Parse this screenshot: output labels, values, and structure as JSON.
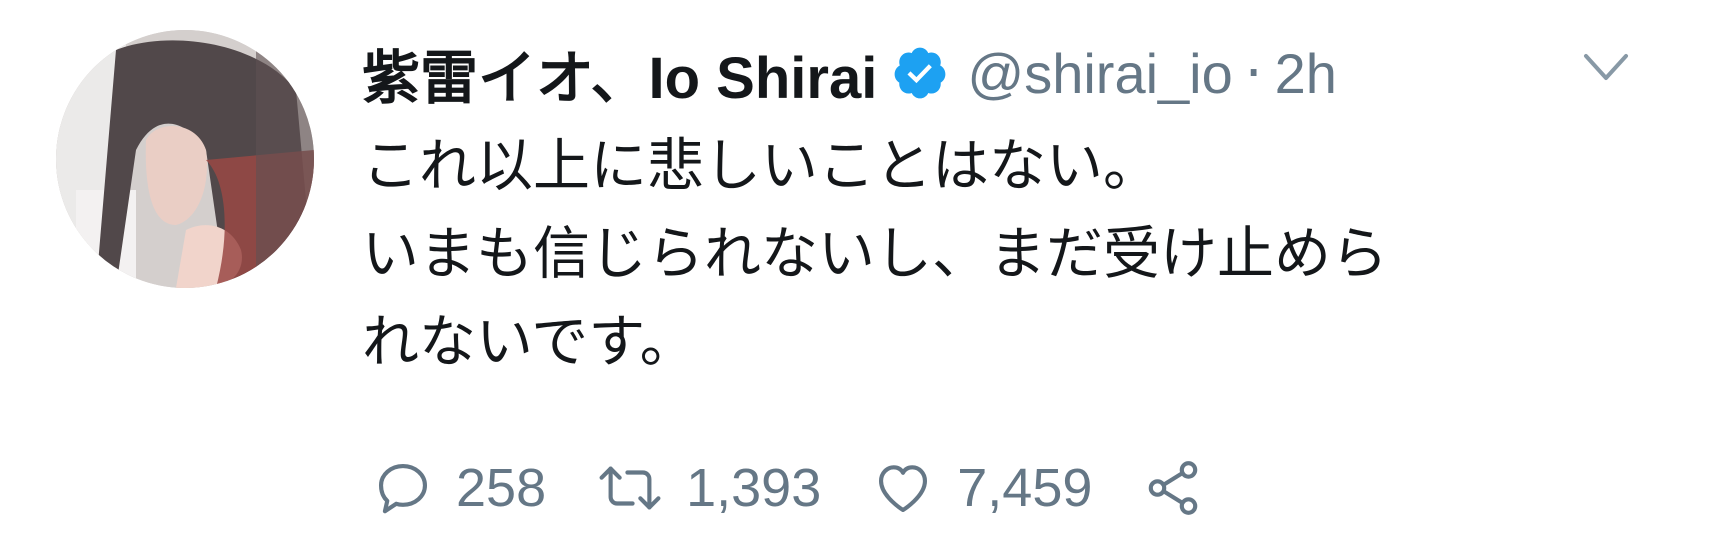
{
  "tweet": {
    "display_name": "紫雷イオ、Io Shirai",
    "handle": "@shirai_io",
    "separator": "·",
    "time": "2h",
    "text_lines": [
      "これ以上に悲しいことはない。",
      "いまも信じられないし、まだ受け止めら",
      "れないです。"
    ],
    "icons": {
      "avatar": "profile-photo",
      "verified": "verified-badge-icon",
      "menu": "chevron-down-icon",
      "reply": "reply-icon",
      "retweet": "retweet-icon",
      "like": "heart-icon",
      "share": "share-icon"
    },
    "actions": {
      "reply_count": "258",
      "retweet_count": "1,393",
      "like_count": "7,459"
    },
    "colors": {
      "verified_blue": "#1da1f2",
      "text": "#14171a",
      "secondary": "#657786"
    }
  }
}
